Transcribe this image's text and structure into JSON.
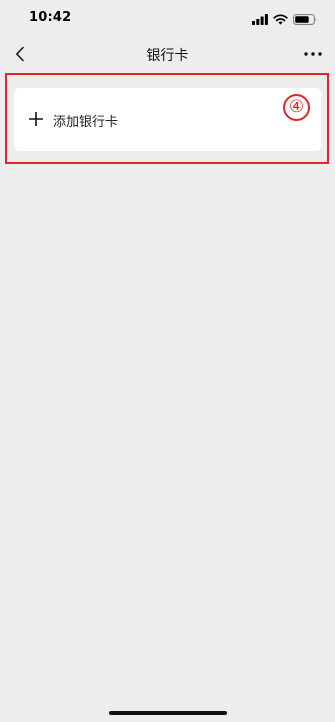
{
  "status_bar": {
    "time": "10:42"
  },
  "nav": {
    "title": "银行卡"
  },
  "add_card": {
    "label": "添加银行卡"
  },
  "annotation": {
    "step_marker": "④"
  },
  "colors": {
    "background": "#ededed",
    "card": "#ffffff",
    "highlight": "#e0262a"
  }
}
